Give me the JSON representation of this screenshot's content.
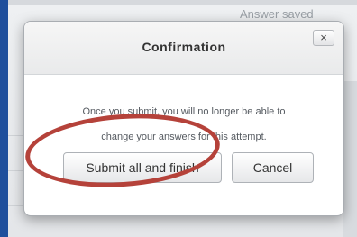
{
  "backdrop": {
    "status_text": "Answer saved"
  },
  "dialog": {
    "title": "Confirmation",
    "close_label": "×",
    "message_line1": "Once you submit, you will no longer be able to",
    "message_line2": "change your answers for this attempt.",
    "submit_label": "Submit all and finish",
    "cancel_label": "Cancel"
  },
  "annotation": {
    "color": "#b5423a",
    "shape": "ellipse"
  }
}
